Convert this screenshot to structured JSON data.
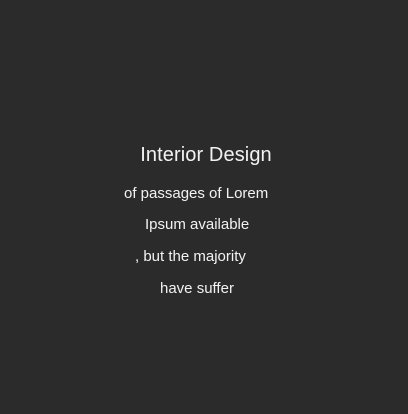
{
  "card": {
    "title": "Interior Design",
    "lines": [
      "of passages of Lorem",
      "Ipsum available",
      ", but the majority",
      "have suffer"
    ]
  },
  "colors": {
    "background": "#2b2b2b",
    "text": "#f2f2f2"
  }
}
